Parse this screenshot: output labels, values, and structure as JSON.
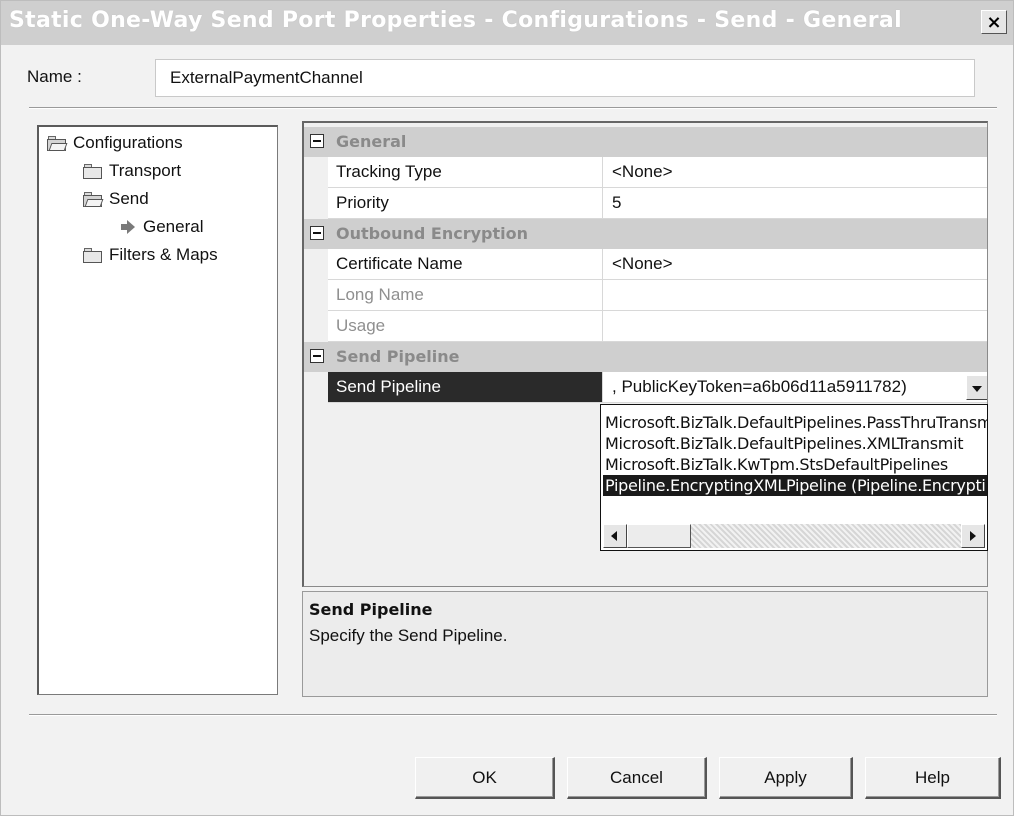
{
  "window": {
    "title": "Static One-Way Send Port Properties - Configurations - Send - General",
    "close_glyph": "×"
  },
  "name_field": {
    "label": "Name :",
    "value": "ExternalPaymentChannel"
  },
  "tree": {
    "items": [
      {
        "label": "Configurations",
        "icon": "folder-open-icon"
      },
      {
        "label": "Transport",
        "icon": "folder-icon"
      },
      {
        "label": "Send",
        "icon": "folder-open-icon"
      },
      {
        "label": "General",
        "icon": "arrow-right-icon"
      },
      {
        "label": "Filters & Maps",
        "icon": "folder-icon"
      }
    ]
  },
  "property_grid": {
    "categories": [
      {
        "label": "General",
        "properties": [
          {
            "name": "Tracking Type",
            "value": "<None>"
          },
          {
            "name": "Priority",
            "value": "5"
          }
        ]
      },
      {
        "label": "Outbound Encryption",
        "properties": [
          {
            "name": "Certificate Name",
            "value": "<None>"
          },
          {
            "name": "Long Name",
            "value": ""
          },
          {
            "name": "Usage",
            "value": ""
          }
        ]
      },
      {
        "label": "Send Pipeline",
        "properties": [
          {
            "name": "Send Pipeline",
            "value": ", PublicKeyToken=a6b06d11a5911782)"
          }
        ]
      }
    ]
  },
  "pipeline_dropdown": {
    "options": [
      "Microsoft.BizTalk.DefaultPipelines.PassThruTransmit",
      "Microsoft.BizTalk.DefaultPipelines.XMLTransmit",
      "Microsoft.BizTalk.KwTpm.StsDefaultPipelines",
      "Pipeline.EncryptingXMLPipeline (Pipeline.EncryptingXMLPipeline"
    ],
    "selected_index": 3
  },
  "description": {
    "title": "Send Pipeline",
    "text": "Specify the Send Pipeline."
  },
  "buttons": {
    "ok": "OK",
    "cancel": "Cancel",
    "apply": "Apply",
    "help": "Help"
  },
  "colors": {
    "title_bar": "#cfcfcf",
    "selection": "#1a1a1a",
    "category_text": "#8a8a8a"
  }
}
